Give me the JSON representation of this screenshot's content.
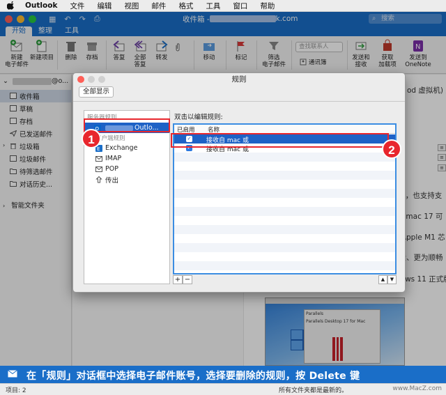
{
  "menubar": {
    "app": "Outlook",
    "items": [
      "文件",
      "编辑",
      "视图",
      "邮件",
      "格式",
      "工具",
      "窗口",
      "帮助"
    ]
  },
  "window": {
    "title_prefix": "收件箱 - ",
    "title_suffix": "k.com",
    "search_placeholder": "搜索"
  },
  "tabs": [
    "开始",
    "整理",
    "工具"
  ],
  "ribbon": {
    "new_email": "新建\n电子邮件",
    "new_item": "新建项目",
    "delete": "删除",
    "archive": "存档",
    "reply": "答复",
    "reply_all": "全部\n答复",
    "forward": "转发",
    "move": "移动",
    "flag": "标记",
    "filter": "筛选\n电子邮件",
    "contact_search_placeholder": "查找联系人",
    "address_book": "通讯簿",
    "send_receive": "发送和\n接收",
    "get_addins": "获取\n加载项",
    "send_onenote": "发送到\nOneNote"
  },
  "folders": {
    "account_suffix": "@o...",
    "items": [
      "收件箱",
      "草稿",
      "存档",
      "已发送邮件",
      "垃圾箱",
      "垃圾邮件",
      "待筛选邮件",
      "对话历史..."
    ],
    "smart": "智能文件夹"
  },
  "reading": {
    "line1": "od 虚拟机) 支",
    "line2": "M1，也支持支",
    "line3": "op mac 17 可",
    "line4": "或 Apple M1 芯",
    "line5": "强大、更为顺畅",
    "line6": "dows 11 正式版",
    "screenshot_brand": "Parallels",
    "screenshot_sub": "Parallels Desktop 17 for Mac"
  },
  "dialog": {
    "title": "规则",
    "show_all": "全部显示",
    "server_rules": "服务器规则",
    "server_account": "ost...",
    "selected_account": "Outlo...",
    "client_rules": "客户端规则",
    "accounts": [
      "Exchange",
      "IMAP",
      "POP",
      "传出"
    ],
    "caption": "双击以编辑规则:",
    "col_enabled": "已启用",
    "col_name": "名称",
    "rules": [
      "接收自 mac 或",
      "接收自 mac 或"
    ],
    "add": "+",
    "remove": "−"
  },
  "annotations": {
    "badge1": "1",
    "badge2": "2",
    "caption": "在「规则」对话框中选择电子邮件账号，选择要删除的规则，按 Delete 键"
  },
  "status": {
    "items": "项目: 2",
    "sync": "所有文件夹都是最新的。",
    "watermark": "www.MacZ.com"
  },
  "colors": {
    "brand_blue": "#1a6ec8",
    "selection_blue": "#1e62c6",
    "annotation_red": "#e8262d"
  }
}
